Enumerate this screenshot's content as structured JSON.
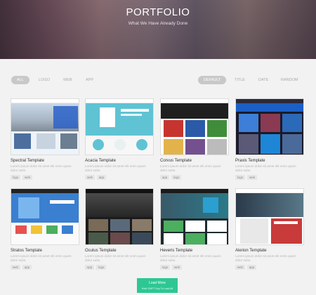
{
  "hero": {
    "title": "PORTFOLIO",
    "subtitle": "What We Have Already Done"
  },
  "filters_left": [
    "ALL",
    "LOGO",
    "WEB",
    "APP"
  ],
  "filters_right": [
    "DEFAULT",
    "TITLE",
    "DATE",
    "RANDOM"
  ],
  "cards": [
    {
      "title": "Spectral Template",
      "desc": "Lorem ipsum dolor sit amet elit enim quam dolor subs.",
      "tags": [
        "logo",
        "web"
      ]
    },
    {
      "title": "Acacia Template",
      "desc": "Lorem ipsum dolor sit amet elit enim quam dolor subs.",
      "tags": [
        "web",
        "app"
      ]
    },
    {
      "title": "Corvus Template",
      "desc": "Lorem ipsum dolor sit amet elit enim quam dolor subs.",
      "tags": [
        "app",
        "logo"
      ]
    },
    {
      "title": "Praxis Template",
      "desc": "Lorem ipsum dolor sit amet elit enim quam dolor subs.",
      "tags": [
        "logo",
        "web"
      ]
    },
    {
      "title": "Stratos Template",
      "desc": "Lorem ipsum dolor sit amet elit enim quam dolor subs.",
      "tags": [
        "web",
        "app"
      ]
    },
    {
      "title": "Oculus Template",
      "desc": "Lorem ipsum dolor sit amet elit enim quam dolor subs.",
      "tags": [
        "app",
        "logo"
      ]
    },
    {
      "title": "Heveris Template",
      "desc": "Lorem ipsum dolor sit amet elit enim quam dolor subs.",
      "tags": [
        "logo",
        "web"
      ]
    },
    {
      "title": "Alerion Template",
      "desc": "Lorem ipsum dolor sit amet elit enim quam dolor subs.",
      "tags": [
        "web",
        "app"
      ]
    }
  ],
  "load_more": {
    "label": "Load More",
    "hint": "Hold SHIFT Key To Load All"
  },
  "colors": {
    "accent": "#2ec794",
    "active_filter": "#c8c8c8"
  }
}
